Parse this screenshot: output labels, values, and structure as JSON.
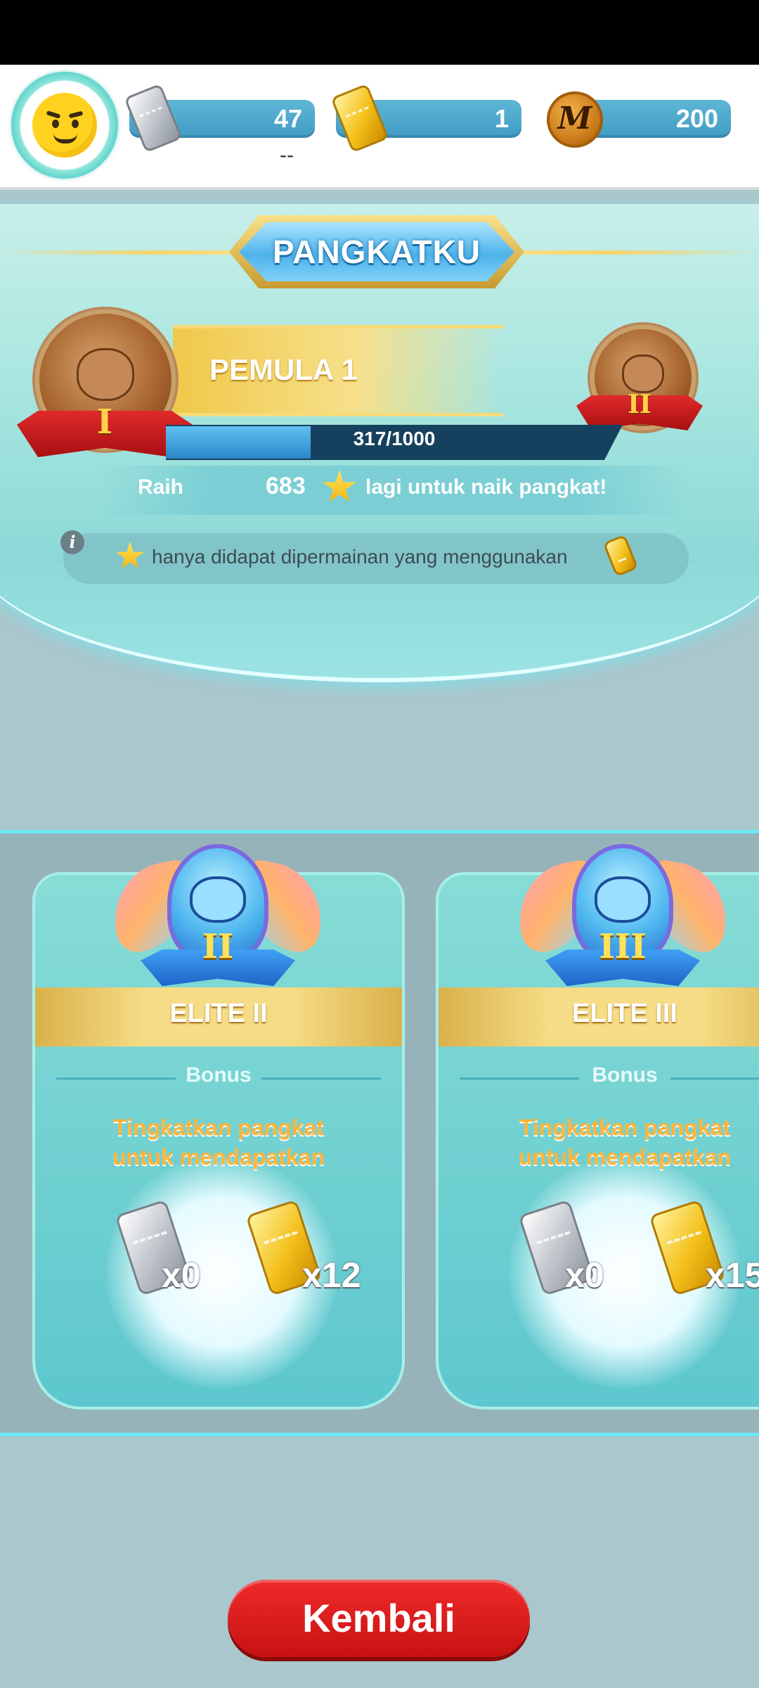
{
  "header": {
    "silver_tickets": "47",
    "gold_tickets": "1",
    "coins": "200",
    "coin_symbol": "M",
    "sub_value": "--"
  },
  "rank": {
    "title": "PANGKATKU",
    "current_rank": "PEMULA 1",
    "current_numeral": "I",
    "next_numeral": "II",
    "progress_text": "317/1000",
    "progress_fraction": 0.317,
    "reach_label": "Raih",
    "reach_amount": "683",
    "reach_suffix": "lagi untuk naik pangkat!",
    "info_icon": "i",
    "info_text": "hanya didapat dipermainan yang menggunakan"
  },
  "cards": [
    {
      "numeral": "II",
      "title": "ELITE II",
      "bonus_label": "Bonus",
      "description": "Tingkatkan pangkat\nuntuk mendapatkan",
      "silver_reward": "x0",
      "gold_reward": "x12"
    },
    {
      "numeral": "III",
      "title": "ELITE III",
      "bonus_label": "Bonus",
      "description": "Tingkatkan pangkat\nuntuk mendapatkan",
      "silver_reward": "x0",
      "gold_reward": "x15"
    }
  ],
  "footer": {
    "back_label": "Kembali"
  },
  "colors": {
    "accent_red": "#e02a2a",
    "pill_blue": "#3f9cc4",
    "card_teal": "#6ecfd0",
    "gold": "#f6dc86"
  }
}
